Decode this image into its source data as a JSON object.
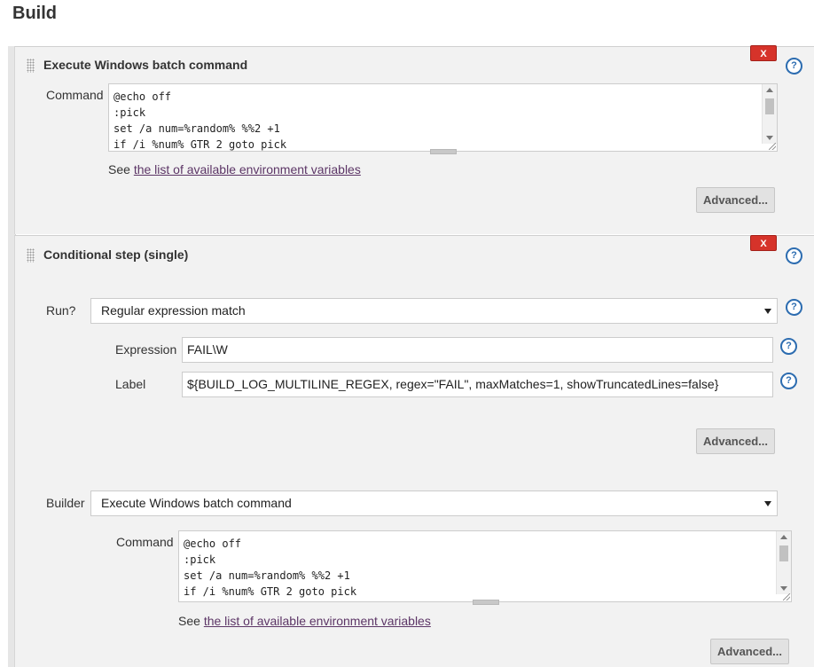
{
  "page": {
    "title": "Build"
  },
  "common": {
    "delete_label": "X",
    "help_label": "?",
    "see_prefix": "See ",
    "env_link": "the list of available environment variables",
    "advanced_label": "Advanced..."
  },
  "step1": {
    "title": "Execute Windows batch command",
    "command_label": "Command",
    "command_value": "@echo off\n:pick\nset /a num=%random% %%2 +1\nif /i %num% GTR 2 goto pick"
  },
  "step2": {
    "title": "Conditional step (single)",
    "run_label": "Run?",
    "run_value": "Regular expression match",
    "expression_label": "Expression",
    "expression_value": "FAIL\\W",
    "label_label": "Label",
    "label_value": "${BUILD_LOG_MULTILINE_REGEX, regex=\"FAIL\", maxMatches=1, showTruncatedLines=false}",
    "builder_label": "Builder",
    "builder_value": "Execute Windows batch command",
    "command_label": "Command",
    "command_value": "@echo off\n:pick\nset /a num=%random% %%2 +1\nif /i %num% GTR 2 goto pick"
  },
  "icons": {
    "delete": "close-x",
    "help": "question-circle",
    "drag": "drag-handle",
    "caret": "chevron-down"
  },
  "colors": {
    "delete_bg": "#d6332a",
    "help_blue": "#2c6cb0",
    "link": "#5c3566",
    "panel_bg": "#f2f2f2"
  }
}
